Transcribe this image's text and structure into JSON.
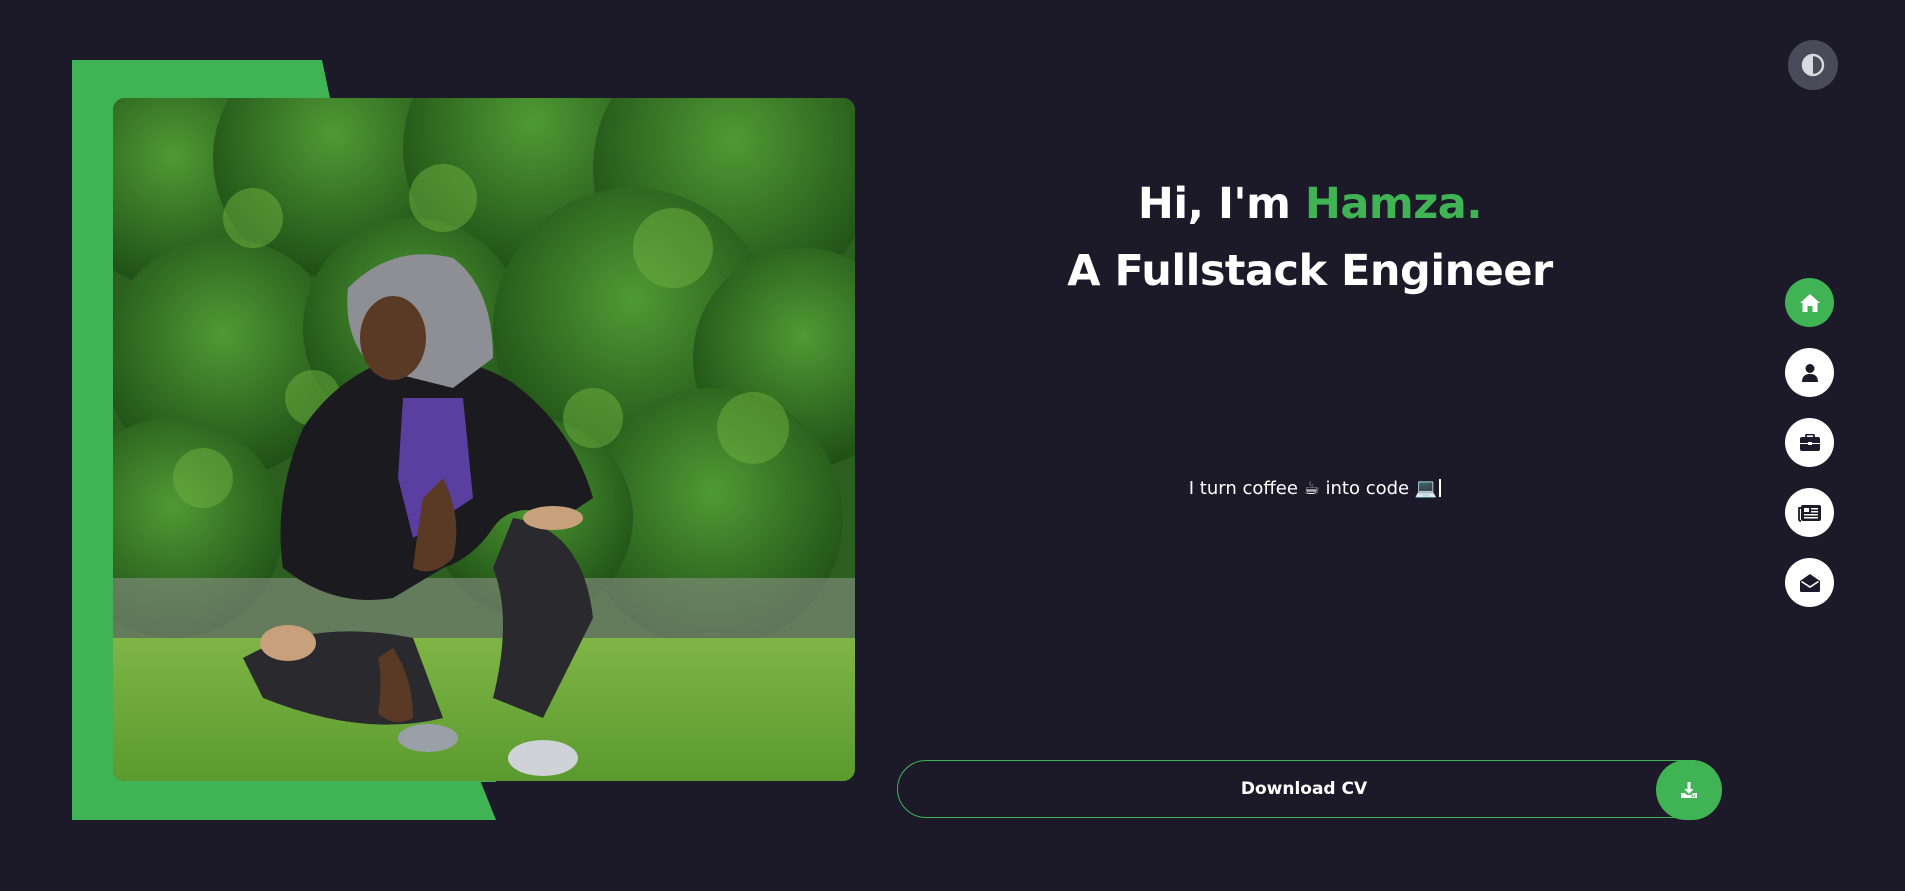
{
  "hero": {
    "greeting": "Hi, I'm ",
    "name": "Hamza.",
    "title": "A Fullstack Engineer"
  },
  "tagline": "I turn coffee ☕ into code 💻",
  "download": {
    "label": "Download CV",
    "icon": "download-icon"
  },
  "theme_toggle": {
    "icon": "contrast-icon"
  },
  "nav": {
    "items": [
      {
        "icon": "home-icon",
        "active": true
      },
      {
        "icon": "user-icon",
        "active": false
      },
      {
        "icon": "briefcase-icon",
        "active": false
      },
      {
        "icon": "newspaper-icon",
        "active": false
      },
      {
        "icon": "envelope-open-icon",
        "active": false
      }
    ]
  },
  "colors": {
    "background": "#1c1a29",
    "accent": "#40b454",
    "text": "#ffffff",
    "toggle_bg": "#4a4a58"
  }
}
